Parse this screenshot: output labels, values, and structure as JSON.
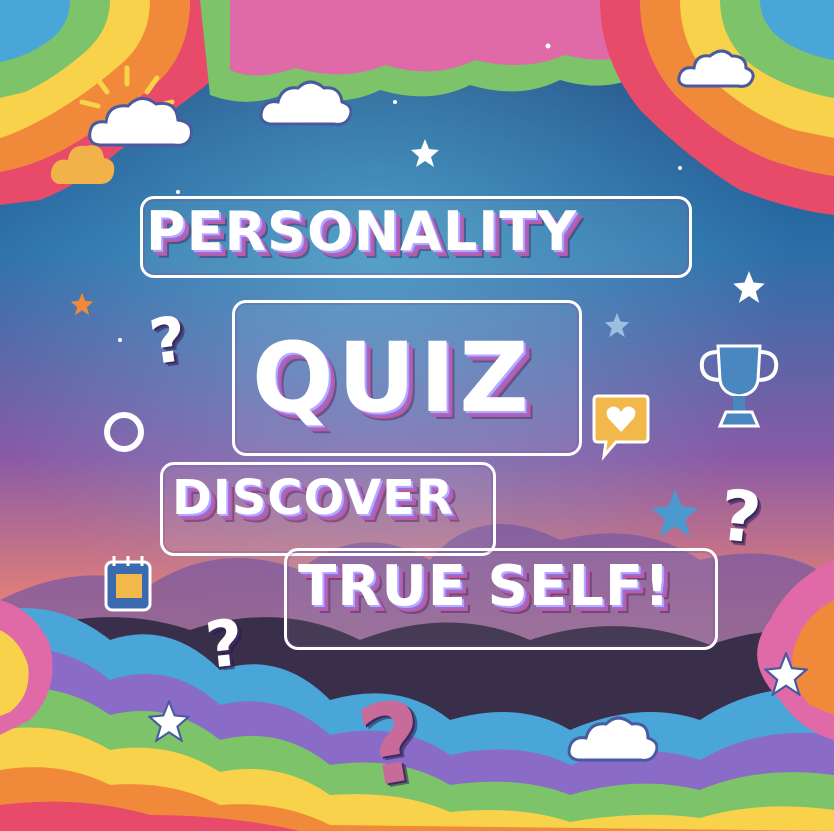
{
  "poster": {
    "line1": "PERSONALITY",
    "line2": "QUIZ",
    "line3": "DISCOVER",
    "line4": "TRUE SELF!",
    "question_mark": "?"
  },
  "colors": {
    "sky_top": "#1d4a84",
    "sky_mid": "#7d4fa0",
    "sky_low": "#f0c25a",
    "rainbow": [
      "#e84a6a",
      "#f08a3a",
      "#f7d24a",
      "#7cc36a",
      "#4aa6d8",
      "#8a6cc8",
      "#e06aa8"
    ]
  },
  "icons": [
    "sun-icon",
    "cloud-icon",
    "star-icon",
    "question-mark-icon",
    "trophy-icon",
    "heart-bubble-icon",
    "notebook-icon",
    "circle-outline-icon"
  ]
}
